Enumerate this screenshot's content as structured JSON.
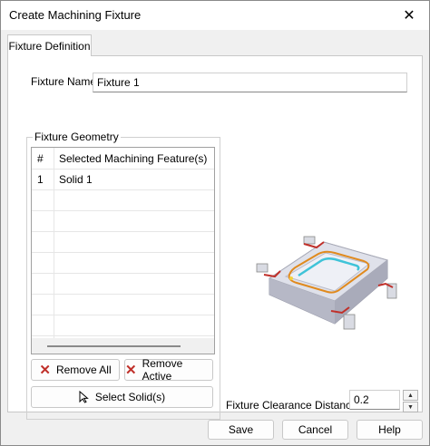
{
  "window": {
    "title": "Create Machining Fixture",
    "close_glyph": "✕"
  },
  "tabs": [
    {
      "label": "Fixture Definition",
      "active": true
    }
  ],
  "fixture_name": {
    "label": "Fixture Name:",
    "value": "Fixture 1"
  },
  "geometry": {
    "group_label": "Fixture Geometry",
    "columns": [
      "#",
      "Selected Machining Feature(s)"
    ],
    "rows": [
      {
        "num": "1",
        "feature": "Solid 1"
      }
    ],
    "remove_all_label": "Remove All",
    "remove_active_label": "Remove Active",
    "select_solids_label": "Select Solid(s)"
  },
  "clearance": {
    "label": "Fixture Clearance Distance",
    "value": "0.2"
  },
  "footer": {
    "save_label": "Save",
    "cancel_label": "Cancel",
    "help_label": "Help"
  },
  "colors": {
    "accent_red": "#c0302a",
    "fixture_orange": "#e08a1e",
    "fixture_cyan": "#3fc3d8"
  }
}
